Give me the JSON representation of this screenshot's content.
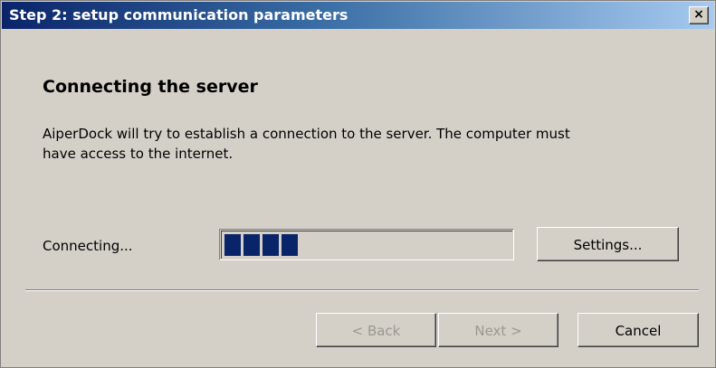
{
  "window": {
    "title": "Step 2: setup communication parameters",
    "close_label": "×"
  },
  "content": {
    "heading": "Connecting the server",
    "description_line1": "AiperDock will try to establish a connection to the server. The computer must",
    "description_line2": "have access to the internet."
  },
  "progress": {
    "status_text": "Connecting...",
    "blocks_filled": 4,
    "color": "#0a246a"
  },
  "buttons": {
    "settings": "Settings...",
    "back": "< Back",
    "next": "Next >",
    "cancel": "Cancel"
  },
  "theme": {
    "dialog_background": "#d4d0c8",
    "titlebar_start": "#0a246a",
    "titlebar_end": "#a6caf0"
  }
}
